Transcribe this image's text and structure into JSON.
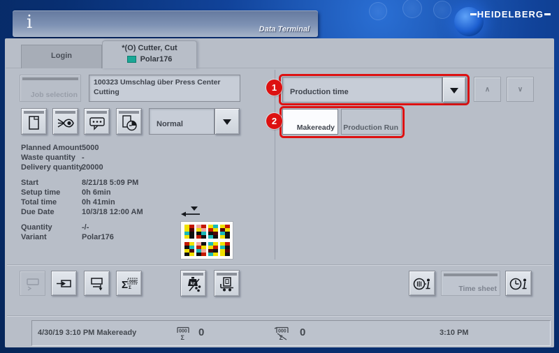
{
  "window": {
    "brand": "HEIDELBERG",
    "app_title": "Data Terminal",
    "info_symbol": "i"
  },
  "tabs": {
    "login": "Login",
    "active_line1": "*(O) Cutter, Cut",
    "active_line2": "Polar176"
  },
  "job": {
    "selection": "Job selection",
    "info_line1": "100323 Umschlag über Press Center",
    "info_line2": "Cutting",
    "mode": "Normal"
  },
  "details": {
    "g1": [
      {
        "l": "Planned Amount",
        "v": "5000"
      },
      {
        "l": "Waste quantity",
        "v": "-"
      },
      {
        "l": "Delivery quantity",
        "v": "20000"
      }
    ],
    "g2": [
      {
        "l": "Start",
        "v": "8/21/18 5:09 PM"
      },
      {
        "l": "Setup time",
        "v": "0h 6min"
      },
      {
        "l": "Total time",
        "v": "0h 41min"
      },
      {
        "l": "Due Date",
        "v": "10/3/18 12:00 AM"
      }
    ],
    "g3": [
      {
        "l": "Quantity",
        "v": "-/-"
      },
      {
        "l": "Variant",
        "v": "Polar176"
      }
    ]
  },
  "right": {
    "marker1": "1",
    "marker2": "2",
    "time_type": "Production time",
    "makeready": "Makeready",
    "production_run": "Production Run",
    "up": "∧",
    "down": "∨"
  },
  "toolbar": {
    "time_sheet": "Time sheet"
  },
  "status": {
    "left": "4/30/19 3:10 PM Makeready",
    "counter1": "0",
    "counter2": "0",
    "time": "3:10 PM"
  },
  "icons": {
    "sigma": "Σ",
    "digits": "000",
    "kg": "kg"
  },
  "colors": {
    "accent_red": "#dd1111",
    "status_teal": "#1aa796",
    "navy": "#0a3c86",
    "panel": "#b8bec8"
  },
  "thumbnail": {
    "groups": [
      [
        "#f0e000",
        "#c41800",
        "#f0e000",
        "#500008",
        "#18b8b8",
        "#101010",
        "#f0e000",
        "#101010"
      ],
      [
        "#f0a8a0",
        "#c41800",
        "#f0e000",
        "#f0a8a0",
        "#101010",
        "#18b8b8",
        "#c41800",
        "#101010"
      ],
      [
        "#f0e000",
        "#18b8b8",
        "#c41800",
        "#f0e000",
        "#101010",
        "#500008",
        "#18b8b8",
        "#101010"
      ],
      [
        "#f0e000",
        "#c41800",
        "#500008",
        "#f0e000",
        "#18b8b8",
        "#101010",
        "#f0e000",
        "#101010"
      ],
      [
        "#c41800",
        "#f0e000",
        "#101010",
        "#18b8b8",
        "#f0e000",
        "#500008",
        "#101010",
        "#f0e000"
      ],
      [
        "#f0a8a0",
        "#101010",
        "#c41800",
        "#f0e000",
        "#18b8b8",
        "#f0a8a0",
        "#101010",
        "#c41800"
      ],
      [
        "#18b8b8",
        "#f0e000",
        "#f0e000",
        "#c41800",
        "#500008",
        "#101010",
        "#18b8b8",
        "#f0e000"
      ],
      [
        "#f0e000",
        "#c41800",
        "#18b8b8",
        "#101010",
        "#f0e000",
        "#500008",
        "#f0e000",
        "#101010"
      ]
    ]
  }
}
